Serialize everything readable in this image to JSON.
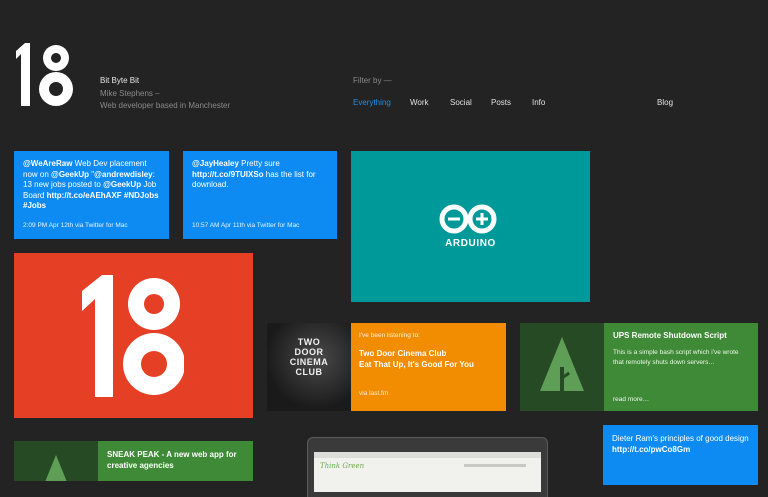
{
  "header": {
    "logo_text": "18",
    "site_title": "Bit Byte Bit",
    "author_line": "Mike Stephens –",
    "tagline": "Web developer based in Manchester",
    "filter_label": "Filter by —",
    "nav": [
      "Everything",
      "Work",
      "Social",
      "Posts",
      "Info"
    ],
    "blog_link": "Blog"
  },
  "tweets": [
    {
      "handle": "@WeAreRaw",
      "text1": " Web Dev placement now on ",
      "mention1": "@GeekUp",
      "text2": " \"",
      "mention2": "@andrewdisley",
      "text3": ": 13 new jobs posted to ",
      "mention3": "@GeekUp",
      "text4": " Job Board ",
      "link": "http://t.co/eAEhAXF",
      "hashtags": " #NDJobs #Jobs",
      "meta": "2:09 PM Apr 12th via Twitter for Mac"
    },
    {
      "handle": "@JayHealey",
      "text1": " Pretty sure ",
      "link": "http://t.co/9TUIXSo",
      "text2": " has the list for download.",
      "meta": "10:57 AM Apr 11th via Twitter for Mac"
    }
  ],
  "arduino": {
    "label": "ARDUINO"
  },
  "big_logo": {
    "text": "18"
  },
  "music": {
    "album_art_text": [
      "TWO",
      "DOOR",
      "CINEMA",
      "CLUB"
    ],
    "label": "I've been listening to:",
    "title_line1": "Two Door Cinema Club",
    "title_line2": "Eat That Up, It's Good For You",
    "via": "via last.fm"
  },
  "posts": [
    {
      "title": "UPS Remote Shutdown Script",
      "body": "This is a simple bash script which i've wrote that remotely shuts down servers…",
      "more": "read more…"
    },
    {
      "title": "SNEAK PEAK - A new web app for creative agencies"
    }
  ],
  "tweet3": {
    "text": "Dieter Ram's principles of good design ",
    "link": "http://t.co/pwCo8Gm"
  },
  "laptop": {
    "brand": "Think Green"
  },
  "colors": {
    "background": "#232323",
    "blue": "#0d8bf2",
    "teal": "#009999",
    "red": "#e53f25",
    "orange": "#f28c00",
    "green": "#3f8a36",
    "dark_green": "#264b24",
    "nav_active": "#1a8fe6"
  }
}
